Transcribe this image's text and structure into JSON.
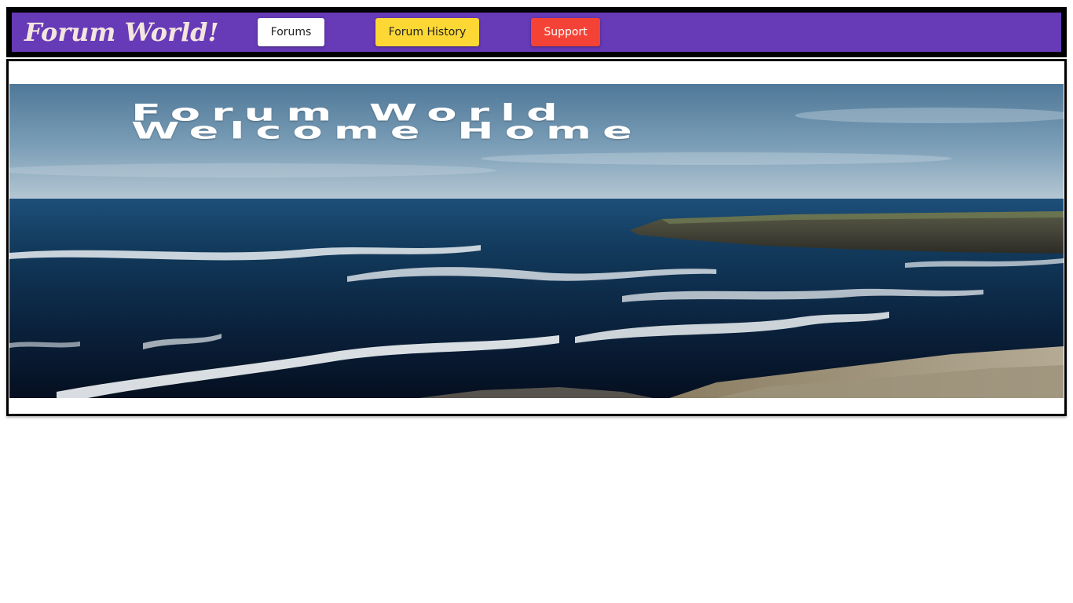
{
  "header": {
    "brand": "Forum World!",
    "nav": {
      "forums_label": "Forums",
      "history_label": "Forum History",
      "support_label": "Support"
    },
    "colors": {
      "bar": "#673ab7",
      "forums_button": "#ffffff",
      "history_button": "#fdd835",
      "support_button": "#f44336"
    }
  },
  "hero": {
    "title_line1": "Forum World",
    "title_line2": "Welcome Home",
    "image": "coastal-sea-cliff-photo"
  }
}
